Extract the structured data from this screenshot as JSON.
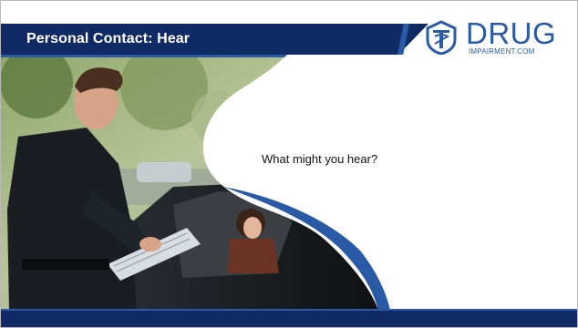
{
  "header": {
    "title": "Personal Contact: Hear"
  },
  "logo": {
    "word": "DRUG",
    "subtitle": "IMPAIRMENT.COM",
    "icon": "caduceus-icon",
    "color": "#2b5aa6"
  },
  "body": {
    "question": "What might you hear?"
  },
  "colors": {
    "navy": "#0f2a64",
    "accent_blue": "#2a5aa6"
  }
}
